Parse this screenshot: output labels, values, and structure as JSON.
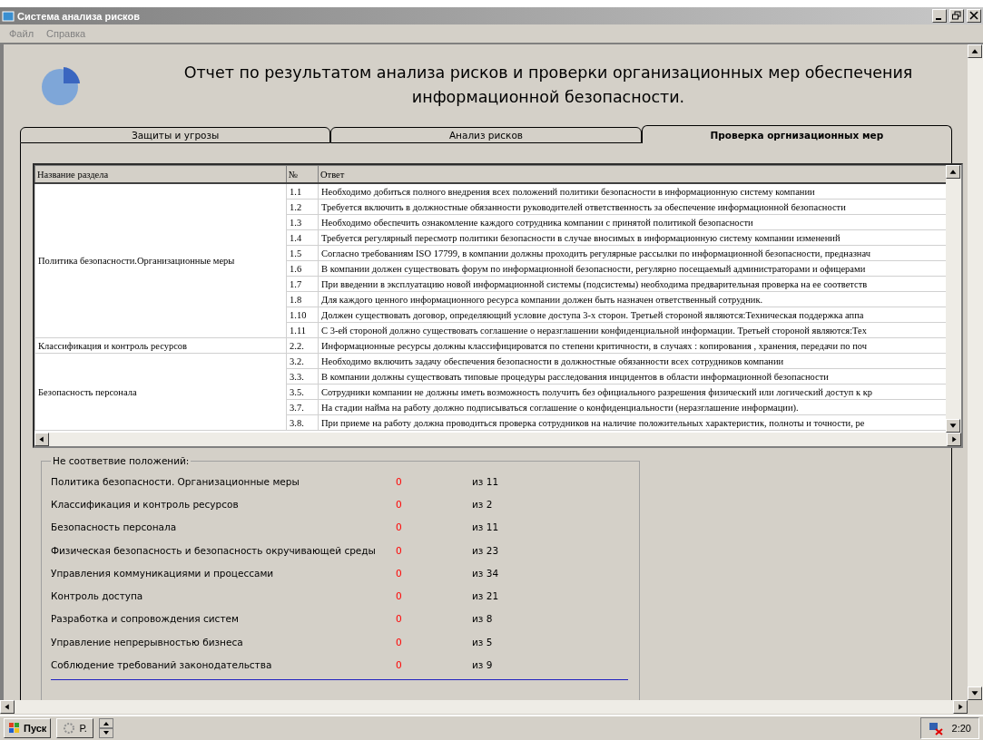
{
  "window": {
    "title": "Система анализа рисков"
  },
  "menu": [
    "Файл",
    "Справка"
  ],
  "report_title": "Отчет по результатом анализа рисков и проверки организационных мер обеспечения информационной безопасности.",
  "tabs": [
    {
      "label": "Защиты и угрозы",
      "selected": false
    },
    {
      "label": "Анализ рисков",
      "selected": false
    },
    {
      "label": "Проверка оргнизационных мер",
      "selected": true
    }
  ],
  "table": {
    "columns": [
      "Название раздела",
      "№",
      "Ответ"
    ],
    "groups": [
      {
        "section": "Политика безопасности.Организационные меры",
        "rows": [
          {
            "number": "1.1",
            "answer": "Необходимо добиться полного внедрения всех положений политики безопасности в информационную систему компании"
          },
          {
            "number": "1.2",
            "answer": "Требуется включить в должностные обязанности руководителей ответственность за обеспечение информационной безопасности"
          },
          {
            "number": "1.3",
            "answer": "Необходимо обеспечить ознакомление каждого сотрудника компании с принятой политикой безопасности"
          },
          {
            "number": "1.4",
            "answer": "Требуется регулярный пересмотр политики безопасности в случае вносимых в информационную систему компании изменений"
          },
          {
            "number": "1.5",
            "answer": "Согласно требованиям ISO 17799, в компании должны проходить регулярные рассылки по информационной безопасности, предназнач"
          },
          {
            "number": "1.6",
            "answer": "В компании должен существовать форум по информационной безопасности, регулярно посещаемый администраторами и офицерами"
          },
          {
            "number": "1.7",
            "answer": "При введении в эксплуатацию новой информационной системы (подсистемы) необходима предварительная проверка на ее соответств"
          },
          {
            "number": "1.8",
            "answer": "Для каждого ценного информационного ресурса компании должен быть назначен ответственный сотрудник."
          },
          {
            "number": "1.10",
            "answer": "Должен существовать договор,  определяющий условие доступа 3-х сторон. Третьей стороной являются:Техническая поддержка аппа"
          },
          {
            "number": "1.11",
            "answer": "С 3-ей стороной должно существовать соглашение о неразглашении конфиденциальной информации. Третьей стороной являются:Тех"
          }
        ]
      },
      {
        "section": "Классификация и контроль ресурсов",
        "rows": [
          {
            "number": "2.2.",
            "answer": "Информационные ресурсы должны классифицироватся по степени критичности, в случаях : копирования , хранения, передачи по поч"
          }
        ]
      },
      {
        "section": "Безопасность персонала",
        "rows": [
          {
            "number": "3.2.",
            "answer": "Необходимо включить задачу обеспечения безопасности в должностные обязанности всех сотрудников компании"
          },
          {
            "number": "3.3.",
            "answer": "В компании должны существовать типовые процедуры расследования инцидентов в области информационной безопасности"
          },
          {
            "number": "3.5.",
            "answer": "Сотрудники компании не должны иметь возможность получить без официального разрешения физический или логический доступ к кр"
          },
          {
            "number": "3.7.",
            "answer": "На стадии найма на работу должно подписываться соглашение о конфиденциальности (неразглашение информации)."
          },
          {
            "number": "3.8.",
            "answer": "При приеме на работу должна проводиться проверка сотрудников на наличие положительных характеристик, полноты и точности, ре"
          }
        ]
      }
    ]
  },
  "summary": {
    "title": "Не соответвие положений:",
    "rows": [
      {
        "label": "Политика безопасности. Организационные меры",
        "count": "0",
        "total": "из 11"
      },
      {
        "label": "Классификация и контроль ресурсов",
        "count": "0",
        "total": "из 2"
      },
      {
        "label": "Безопасность персонала",
        "count": "0",
        "total": "из 11"
      },
      {
        "label": "Физическая безопасность и безопасность окручивающей среды",
        "count": "0",
        "total": "из 23"
      },
      {
        "label": "Управления коммуникациями и процессами",
        "count": "0",
        "total": "из 34"
      },
      {
        "label": "Контроль доступа",
        "count": "0",
        "total": "из 21"
      },
      {
        "label": "Разработка и сопровождения систем",
        "count": "0",
        "total": "из 8"
      },
      {
        "label": "Управление непрерывностью  бизнеса",
        "count": "0",
        "total": "из 5"
      },
      {
        "label": "Соблюдение требований законодательства",
        "count": "0",
        "total": "из 9"
      }
    ]
  },
  "taskbar": {
    "start": "Пуск",
    "tasks": [
      "Р."
    ],
    "clock": "2:20"
  }
}
